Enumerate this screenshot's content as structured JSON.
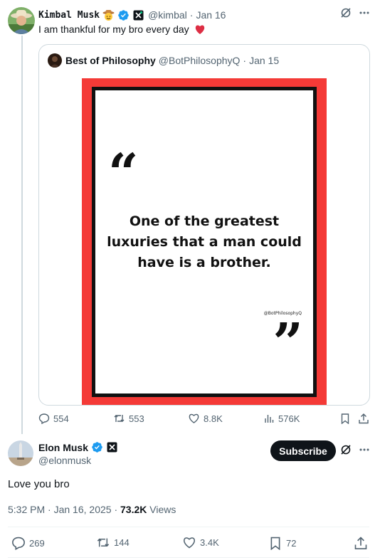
{
  "parent_tweet": {
    "author_name": "Kimbal Musk",
    "author_handle": "@kimbal",
    "date_sep": "·",
    "date": "Jan 16",
    "text": "I am thankful for my bro every day",
    "quote": {
      "author_name": "Best of Philosophy",
      "author_handle": "@BotPhilosophyQ",
      "date_sep": "·",
      "date": "Jan 15",
      "image": {
        "quote_text": "One of the greatest luxuries that a man could have is a brother.",
        "watermark": "@BotPhilosophyQ",
        "open_mark": "“",
        "close_mark": "”",
        "bg_color": "#f43a37"
      }
    },
    "stats": {
      "replies": "554",
      "reposts": "553",
      "likes": "8.8K",
      "views": "576K"
    }
  },
  "main_tweet": {
    "author_name": "Elon Musk",
    "author_handle": "@elonmusk",
    "subscribe_label": "Subscribe",
    "text": "Love you bro",
    "time": "5:32 PM",
    "time_sep": "·",
    "date": "Jan 16, 2025",
    "date_sep": "·",
    "views_count": "73.2K",
    "views_label": "Views",
    "stats": {
      "replies": "269",
      "reposts": "144",
      "likes": "3.4K",
      "bookmarks": "72"
    }
  },
  "colors": {
    "verified": "#1d9bf0",
    "heart": "#e0245e",
    "muted": "#536471"
  },
  "icons": [
    "reply-icon",
    "repost-icon",
    "like-icon",
    "views-icon",
    "bookmark-icon",
    "share-icon",
    "grok-icon",
    "more-icon",
    "verified-badge-icon",
    "x-affiliate-icon",
    "cowboy-emoji-icon",
    "red-heart-icon"
  ]
}
